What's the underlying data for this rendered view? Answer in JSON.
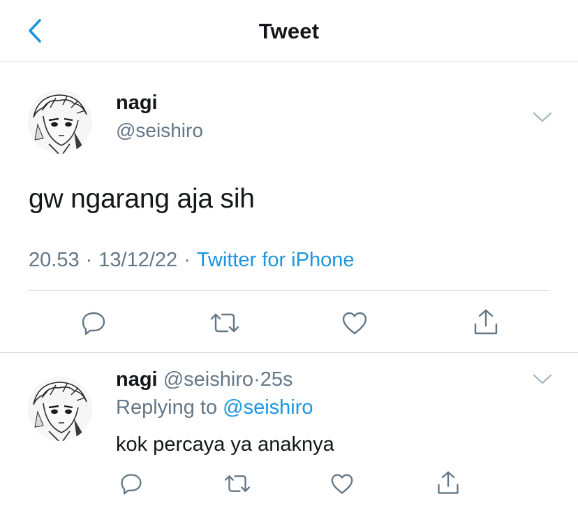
{
  "header": {
    "title": "Tweet",
    "back_icon": "chevron-left-icon",
    "accent_color": "#1b95e0"
  },
  "tweet": {
    "author_name": "nagi",
    "author_handle": "@seishiro",
    "text": "gw ngarang aja sih",
    "time": "20.53",
    "date": "13/12/22",
    "separator": "·",
    "source": "Twitter for iPhone",
    "actions": [
      "reply-icon",
      "retweet-icon",
      "like-icon",
      "share-icon"
    ]
  },
  "reply": {
    "author_name": "nagi",
    "author_handle": "@seishiro",
    "dot": "·",
    "time_ago": "25s",
    "replying_prefix": "Replying to",
    "replying_to": "@seishiro",
    "text": "kok percaya ya anaknya",
    "actions": [
      "reply-icon",
      "retweet-icon",
      "like-icon",
      "share-icon"
    ]
  },
  "colors": {
    "text_primary": "#14171a",
    "text_secondary": "#657786",
    "link": "#1b95e0",
    "divider": "#dcdcdc"
  }
}
